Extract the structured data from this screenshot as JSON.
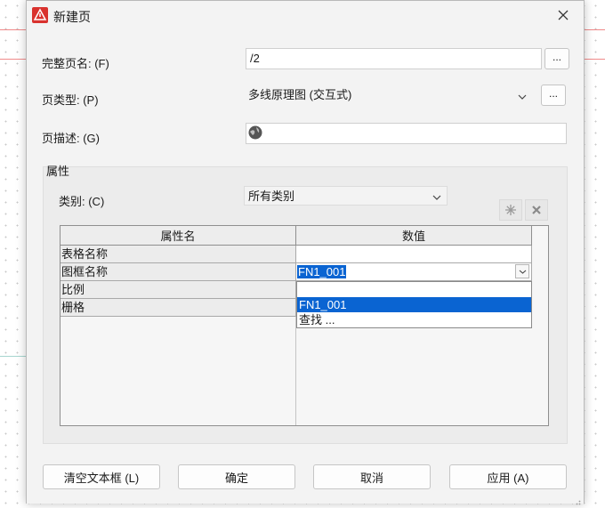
{
  "dialog": {
    "title": "新建页",
    "full_page_name_label": "完整页名: (F)",
    "full_page_name_value": "/2",
    "browse_label": "...",
    "page_type_label": "页类型: (P)",
    "page_type_value": "多线原理图 (交互式)",
    "page_desc_label": "页描述: (G)",
    "page_desc_value": ""
  },
  "properties": {
    "group_title": "属性",
    "category_label": "类别: (C)",
    "category_value": "所有类别",
    "headers": {
      "name": "属性名",
      "value": "数值"
    },
    "rows": [
      {
        "name": "表格名称",
        "value": ""
      },
      {
        "name": "图框名称",
        "value": "FN1_001"
      },
      {
        "name": "比例",
        "value": ""
      },
      {
        "name": "栅格",
        "value": ""
      }
    ],
    "dropdown_options": [
      "",
      "FN1_001",
      "查找 ..."
    ]
  },
  "buttons": {
    "clear": "清空文本框 (L)",
    "ok": "确定",
    "cancel": "取消",
    "apply": "应用 (A)"
  },
  "colors": {
    "selection": "#0a64d2",
    "app_icon": "#d9322e"
  }
}
